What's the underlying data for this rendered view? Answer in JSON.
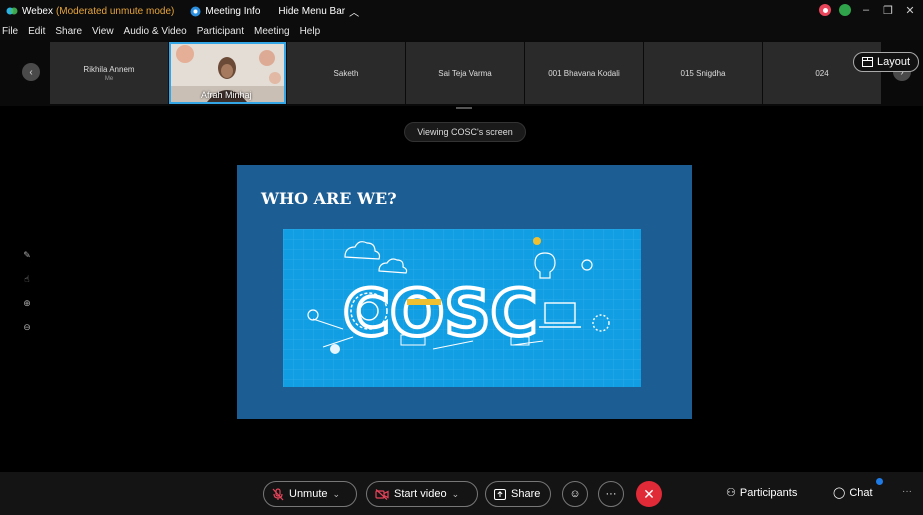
{
  "titlebar": {
    "app": "Webex",
    "mode": "(Moderated unmute mode)",
    "meeting_info": "Meeting Info",
    "hide_menu": "Hide Menu Bar",
    "colors": {
      "mode": "#e6a43a",
      "record": "#e8455b",
      "network": "#2fa44a"
    }
  },
  "menu": [
    "File",
    "Edit",
    "Share",
    "View",
    "Audio & Video",
    "Participant",
    "Meeting",
    "Help"
  ],
  "filmstrip": {
    "tiles": [
      {
        "name": "Rikhila Annem",
        "sub": "Me"
      },
      {
        "name": "Afrah Minhaj",
        "video": true
      },
      {
        "name": "Saketh"
      },
      {
        "name": "Sai Teja Varma"
      },
      {
        "name": "001 Bhavana Kodali"
      },
      {
        "name": "015 Snigdha"
      },
      {
        "name": "024"
      }
    ],
    "layout_label": "Layout"
  },
  "viewing": "Viewing COSC's screen",
  "slide": {
    "title": "WHO ARE WE?",
    "logo_text": "COSC",
    "colors": {
      "bg": "#1c5d94",
      "image_bg": "#129ee3"
    }
  },
  "controls": {
    "unmute": "Unmute",
    "start_video": "Start video",
    "share": "Share",
    "participants": "Participants",
    "chat": "Chat",
    "colors": {
      "end_call": "#e02a38",
      "chat_badge": "#1f7be6"
    }
  }
}
